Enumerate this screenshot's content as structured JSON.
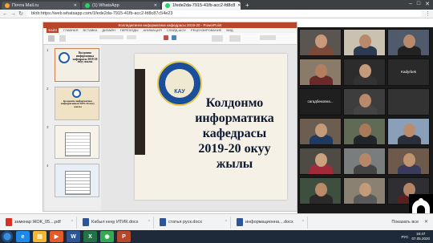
{
  "browser": {
    "tabs": [
      {
        "label": "Почта Mail.ru",
        "color": "#f5a623",
        "active": false
      },
      {
        "label": "(1) WhatsApp",
        "color": "#25d366",
        "active": false
      },
      {
        "label": "1fede2da-7915-41fb-acc2-fd8c8",
        "color": "#25d366",
        "active": true
      }
    ],
    "new_tab": "+",
    "window_controls": {
      "minimize": "–",
      "maximize": "□",
      "close": "✕"
    },
    "url": "blob:https://web.whatsapp.com/1fede2da-7915-41fb-acc2-fd8c87c54e23",
    "nav": {
      "back": "←",
      "forward": "→",
      "reload": "↻",
      "menu": "⋮"
    }
  },
  "powerpoint": {
    "title": "Колледжтинги информатика кафедрасы 2019-20 - PowerPoint",
    "ribbon_tabs": [
      "ФАЙЛ",
      "ГЛАВНАЯ",
      "ВСТАВКА",
      "ДИЗАЙН",
      "ПЕРЕХОДЫ",
      "АНИМАЦИЯ",
      "СЛАЙД-ШОУ",
      "РЕЦЕНЗИРОВАНИЕ",
      "ВИД"
    ],
    "thumbnails": [
      {
        "num": "1",
        "text": "Колдонмо информатика кафедрасы 2019-20 окуу жылы"
      },
      {
        "num": "2",
        "text": "Колдонмо информатика кафедрасынын 2019-20 окуу жылы"
      },
      {
        "num": "3",
        "text": ""
      },
      {
        "num": "4",
        "text": ""
      }
    ],
    "slide": {
      "title_lines": [
        "Колдонмо",
        "информатика",
        "кафедрасы",
        "2019-20 окуу",
        "жылы"
      ],
      "logo_text": "КАУ"
    }
  },
  "zoom": {
    "participants": [
      {
        "name": "",
        "bg": "#5a5550",
        "skin": "#c89a7a",
        "shirt": "#7a4a3a"
      },
      {
        "name": "",
        "bg": "#c9c2b0",
        "skin": "#b8896a",
        "shirt": "#2f3a52"
      },
      {
        "name": "",
        "bg": "#4f5b6a",
        "skin": "#b88a6a",
        "shirt": "#222"
      },
      {
        "name": "",
        "bg": "#8a7a6a",
        "skin": "#b08060",
        "shirt": "#6a2a2a"
      },
      {
        "name": "",
        "bg": "#2c2c2c",
        "skin": "#c49a7a",
        "shirt": "#333"
      },
      {
        "name": "Kadyrbek",
        "bg": "#2a2a2a",
        "skin": "",
        "shirt": ""
      },
      {
        "name": "сагадбековна...",
        "bg": "#1f1f1f",
        "skin": "",
        "shirt": ""
      },
      {
        "name": "",
        "bg": "#3d3d3d",
        "skin": "#b8896a",
        "shirt": "#444"
      },
      {
        "name": "",
        "bg": "#333",
        "skin": "",
        "shirt": ""
      },
      {
        "name": "",
        "bg": "#6b5d50",
        "skin": "#c39a7a",
        "shirt": "#1f3a60"
      },
      {
        "name": "",
        "bg": "#5f6a57",
        "skin": "#a87a5a",
        "shirt": "#22252a"
      },
      {
        "name": "",
        "bg": "#8aa0b8",
        "skin": "#b88c6c",
        "shirt": "#2b2f3a"
      },
      {
        "name": "",
        "bg": "#4e4a44",
        "skin": "#c9a27f",
        "shirt": "#a32a3a"
      },
      {
        "name": "",
        "bg": "#7a7d7e",
        "skin": "#b58867",
        "shirt": "#444"
      },
      {
        "name": "",
        "bg": "#6d5a4d",
        "skin": "#c0946e",
        "shirt": "#3a3a5a"
      },
      {
        "name": "",
        "bg": "#3f4f3f",
        "skin": "#b88a68",
        "shirt": "#2a2a2a"
      },
      {
        "name": "",
        "bg": "#8a8172",
        "skin": "#c29b7b",
        "shirt": "#5a5a5a"
      },
      {
        "name": "",
        "bg": "#2f2f33",
        "skin": "#b48464",
        "shirt": "#5a2020"
      }
    ]
  },
  "downloads": {
    "items": [
      {
        "label": "замкнар ЖОК_05....pdf",
        "color": "#d93025"
      },
      {
        "label": "Кабыл кеңү ИТИК.docx",
        "color": "#2b579a"
      },
      {
        "label": "статья руск.docx",
        "color": "#2b579a"
      },
      {
        "label": "информационна....docx",
        "color": "#2b579a"
      }
    ],
    "show_all": "Показать все",
    "close": "✕"
  },
  "taskbar": {
    "apps": [
      {
        "name": "ie-icon",
        "glyph": "e",
        "color": "#1e88e5"
      },
      {
        "name": "explorer-icon",
        "glyph": "▤",
        "color": "#f2b632"
      },
      {
        "name": "media-icon",
        "glyph": "▶",
        "color": "#e45b2a"
      },
      {
        "name": "word-icon",
        "glyph": "W",
        "color": "#2b579a"
      },
      {
        "name": "excel-icon",
        "glyph": "X",
        "color": "#217346"
      },
      {
        "name": "chrome-icon",
        "glyph": "◉",
        "color": "#34a853"
      },
      {
        "name": "powerpoint-icon",
        "glyph": "P",
        "color": "#b7472a"
      }
    ],
    "lang": "РУС",
    "time": "16:47",
    "date": "07.05.2020"
  }
}
